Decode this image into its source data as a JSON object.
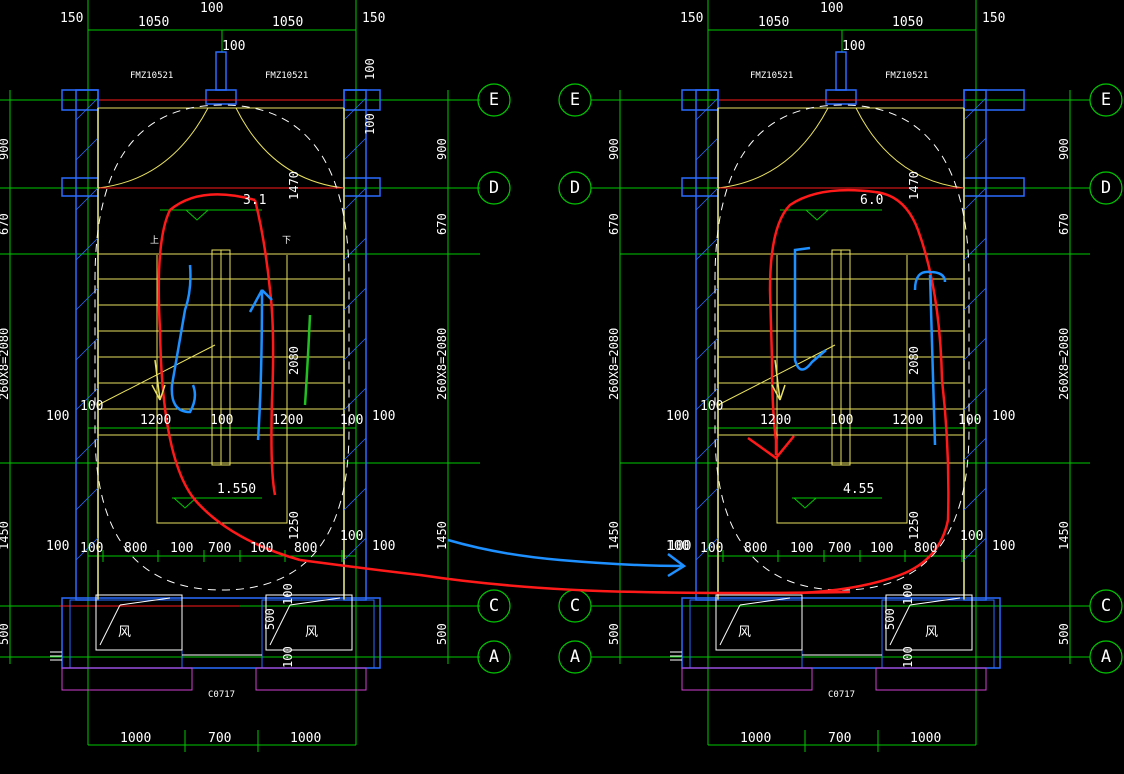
{
  "colors": {
    "background": "#000000",
    "grid": "#00c800",
    "wall": "#2a6cff",
    "steps": "#e8e060",
    "annotation_red": "#ff1a1a",
    "annotation_blue": "#1e90ff",
    "annotation_green": "#22c022",
    "text": "#ffffff",
    "magenta": "#d040d0"
  },
  "left_plan": {
    "top_dims": [
      "150",
      "1050",
      "100",
      "1050",
      "150"
    ],
    "top_sub": "100",
    "door_labels": [
      "FMZ10521",
      "FMZ10521"
    ],
    "right_vert_dims": [
      "100",
      "100"
    ],
    "landing_upper": "3.1",
    "landing_lower": "1.550",
    "flight_dims_row": [
      "100",
      "1200",
      "100",
      "1200",
      "100"
    ],
    "bottom_row": [
      "100",
      "800",
      "100",
      "700",
      "100",
      "800",
      "100"
    ],
    "side_dims_left": [
      "900",
      "670",
      "260X8=2080",
      "1450",
      "500"
    ],
    "side_dims_right": [
      "900",
      "670",
      "260X8=2080",
      "1450",
      "500"
    ],
    "inner_dims": [
      "1470",
      "2080",
      "1250"
    ],
    "up_mark": "上",
    "down_mark": "下",
    "shaft_label": "风",
    "shaft_dims": [
      "500",
      "100",
      "100"
    ],
    "window_label": "C0717",
    "bottom_dims": [
      "1000",
      "700",
      "1000"
    ]
  },
  "right_plan": {
    "top_dims": [
      "150",
      "1050",
      "100",
      "1050",
      "150"
    ],
    "top_sub": "100",
    "door_labels": [
      "FMZ10521",
      "FMZ10521"
    ],
    "landing_upper": "6.0",
    "landing_lower": "4.55",
    "flight_dims_row": [
      "100",
      "1200",
      "100",
      "1200",
      "100"
    ],
    "bottom_row": [
      "100",
      "800",
      "100",
      "700",
      "100",
      "800",
      "100"
    ],
    "side_dims_left": [
      "900",
      "670",
      "260X8=2080",
      "1450",
      "500"
    ],
    "side_dims_right": [
      "900",
      "670",
      "260X8=2080",
      "1450",
      "500"
    ],
    "inner_dims": [
      "1470",
      "2080",
      "1250"
    ],
    "shaft_label": "风",
    "shaft_dims": [
      "500",
      "100",
      "100"
    ],
    "window_label": "C0717",
    "bottom_dims": [
      "1000",
      "700",
      "1000"
    ]
  },
  "axes": [
    "E",
    "D",
    "C",
    "A"
  ]
}
